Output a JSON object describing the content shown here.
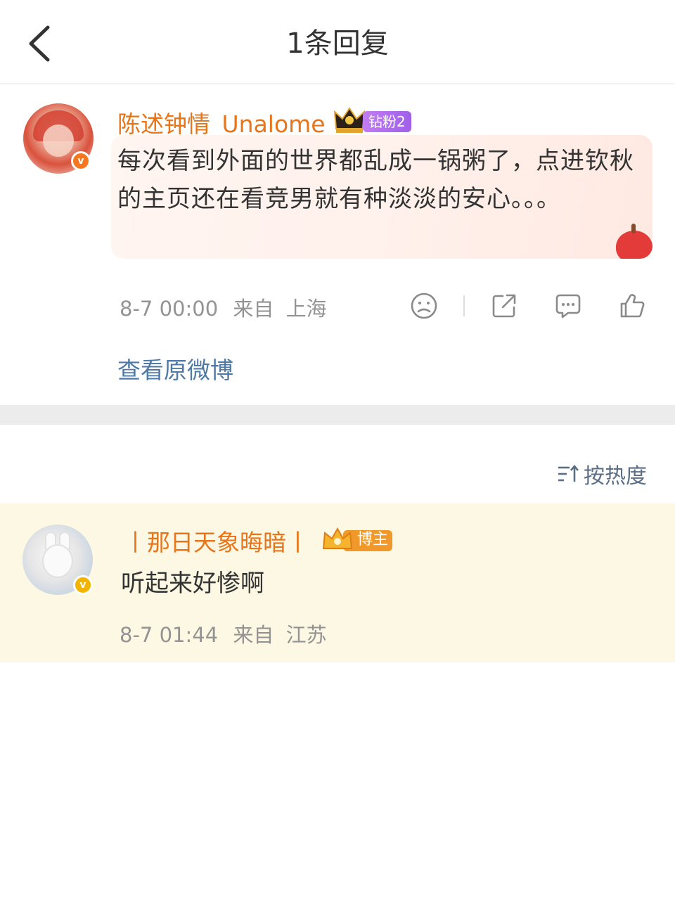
{
  "header": {
    "title": "1条回复"
  },
  "main_comment": {
    "username": "陈述钟情_Unalome",
    "fan_badge": "钻粉2",
    "text": "每次看到外面的世界都乱成一锅粥了，点进钦秋的主页还在看竞男就有种淡淡的安心。。。",
    "time": "8-7 00:00",
    "location_prefix": "来自",
    "location": "上海",
    "view_original": "查看原微博"
  },
  "sort": {
    "label": "按热度"
  },
  "reply": {
    "username": "丨那日天象晦暗丨",
    "badge": "博主",
    "text": "听起来好惨啊",
    "time": "8-7 01:44",
    "location_prefix": "来自",
    "location": "江苏"
  },
  "colors": {
    "username": "#e8751a",
    "link": "#4f7aa8",
    "meta": "#939393",
    "fan_badge": "#a05fe8",
    "reply_bg": "#fdf8e3"
  },
  "icons": [
    "back-arrow-icon",
    "crown-icon",
    "sad-face-icon",
    "share-icon",
    "comment-icon",
    "like-icon",
    "sort-icon"
  ]
}
